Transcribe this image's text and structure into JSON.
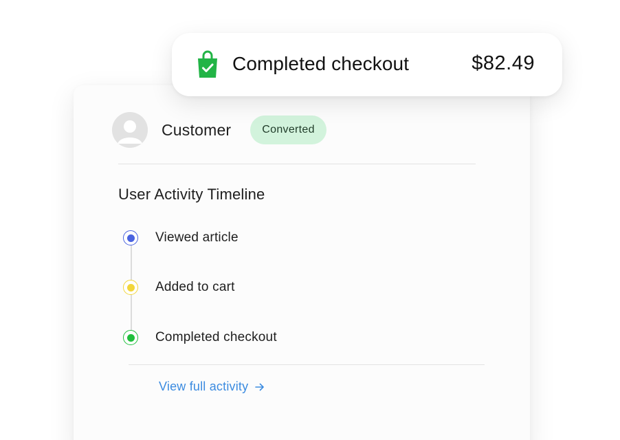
{
  "notification": {
    "icon": "shopping-bag-check-icon",
    "text": "Completed checkout",
    "amount": "$82.49",
    "icon_color": "#22b446"
  },
  "customer": {
    "avatar_icon": "user-avatar-icon",
    "name": "Customer",
    "status": "Converted",
    "status_bg": "#d2f3dc"
  },
  "timeline": {
    "title": "User Activity Timeline",
    "events": [
      {
        "label": "Viewed article",
        "color": "#4a63e0"
      },
      {
        "label": "Added to cart",
        "color": "#f2d63a"
      },
      {
        "label": "Completed checkout",
        "color": "#1fbf3c"
      }
    ],
    "link": {
      "label": "View full activity",
      "icon": "arrow-right-icon",
      "color": "#3b8be0"
    }
  }
}
